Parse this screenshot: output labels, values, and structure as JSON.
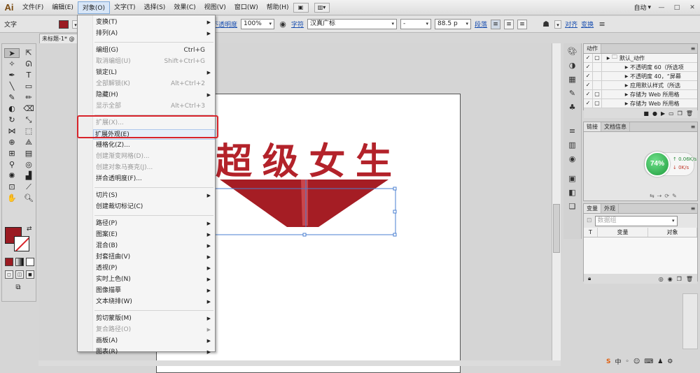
{
  "app": {
    "logo": "Ai"
  },
  "menubar": {
    "items": [
      "文件(F)",
      "编辑(E)",
      "对象(O)",
      "文字(T)",
      "选择(S)",
      "效果(C)",
      "视图(V)",
      "窗口(W)",
      "帮助(H)"
    ],
    "workspace_label": "自动",
    "win_buttons": [
      "—",
      "□",
      "✕"
    ]
  },
  "controlbar": {
    "tool_label": "文字",
    "opacity_label": "不透明度",
    "opacity_value": "100%",
    "char_label": "字符",
    "font_name": "汉真广标",
    "font_style": "-",
    "font_size": "88.5 p",
    "para_label": "段落",
    "align_label": "对齐",
    "transform_label": "变换"
  },
  "document": {
    "tab_title": "未标题-1* @"
  },
  "object_menu": {
    "items": [
      {
        "label": "变换(T)",
        "shortcut": "",
        "sub": true,
        "disabled": false
      },
      {
        "label": "排列(A)",
        "shortcut": "",
        "sub": true,
        "disabled": false
      },
      {
        "label": "编组(G)",
        "shortcut": "Ctrl+G",
        "sub": false,
        "disabled": false
      },
      {
        "label": "取消编组(U)",
        "shortcut": "Shift+Ctrl+G",
        "sub": false,
        "disabled": true
      },
      {
        "label": "锁定(L)",
        "shortcut": "",
        "sub": true,
        "disabled": false
      },
      {
        "label": "全部解锁(K)",
        "shortcut": "Alt+Ctrl+2",
        "sub": false,
        "disabled": true
      },
      {
        "label": "隐藏(H)",
        "shortcut": "",
        "sub": true,
        "disabled": false
      },
      {
        "label": "显示全部",
        "shortcut": "Alt+Ctrl+3",
        "sub": false,
        "disabled": true
      },
      {
        "label": "扩展(X)...",
        "shortcut": "",
        "sub": false,
        "disabled": true
      },
      {
        "label": "扩展外观(E)",
        "shortcut": "",
        "sub": false,
        "disabled": false,
        "highlight": true
      },
      {
        "label": "栅格化(Z)...",
        "shortcut": "",
        "sub": false,
        "disabled": false
      },
      {
        "label": "创建渐变网格(D)...",
        "shortcut": "",
        "sub": false,
        "disabled": true
      },
      {
        "label": "创建对象马赛克(J)...",
        "shortcut": "",
        "sub": false,
        "disabled": true
      },
      {
        "label": "拼合透明度(F)...",
        "shortcut": "",
        "sub": false,
        "disabled": false
      },
      {
        "label": "切片(S)",
        "shortcut": "",
        "sub": true,
        "disabled": false
      },
      {
        "label": "创建裁切标记(C)",
        "shortcut": "",
        "sub": false,
        "disabled": false
      },
      {
        "label": "路径(P)",
        "shortcut": "",
        "sub": true,
        "disabled": false
      },
      {
        "label": "图案(E)",
        "shortcut": "",
        "sub": true,
        "disabled": false
      },
      {
        "label": "混合(B)",
        "shortcut": "",
        "sub": true,
        "disabled": false
      },
      {
        "label": "封套扭曲(V)",
        "shortcut": "",
        "sub": true,
        "disabled": false
      },
      {
        "label": "透视(P)",
        "shortcut": "",
        "sub": true,
        "disabled": false
      },
      {
        "label": "实时上色(N)",
        "shortcut": "",
        "sub": true,
        "disabled": false
      },
      {
        "label": "图像描摹",
        "shortcut": "",
        "sub": true,
        "disabled": false
      },
      {
        "label": "文本绕排(W)",
        "shortcut": "",
        "sub": true,
        "disabled": false
      },
      {
        "label": "剪切蒙版(M)",
        "shortcut": "",
        "sub": true,
        "disabled": false
      },
      {
        "label": "复合路径(O)",
        "shortcut": "",
        "sub": true,
        "disabled": true
      },
      {
        "label": "画板(A)",
        "shortcut": "",
        "sub": true,
        "disabled": false
      },
      {
        "label": "图表(R)",
        "shortcut": "",
        "sub": true,
        "disabled": false
      }
    ]
  },
  "artwork": {
    "text": "超级女生",
    "color": "#b3222a"
  },
  "actions_panel": {
    "tab": "动作",
    "rows": [
      {
        "label": "默认_动作",
        "level": 0,
        "folder": true
      },
      {
        "label": "不透明度 60（所选项",
        "level": 1
      },
      {
        "label": "不透明度 40，“屏幕",
        "level": 1
      },
      {
        "label": "应用默认样式（所选",
        "level": 1
      },
      {
        "label": "存储为 Web 所用格",
        "level": 1
      },
      {
        "label": "存储为 Web 所用格",
        "level": 1
      }
    ]
  },
  "links_panel": {
    "tabs": [
      "链接",
      "文档信息"
    ]
  },
  "net_widget": {
    "percent": "74%",
    "up": "0.06K/s",
    "down": "0K/s"
  },
  "variables_panel": {
    "tabs": [
      "变量",
      "外观"
    ],
    "dataset_placeholder": "数据组",
    "columns": [
      "T",
      "变量",
      "对象"
    ]
  },
  "colors": {
    "accent_red": "#d8232a",
    "fill": "#9b1b22"
  }
}
